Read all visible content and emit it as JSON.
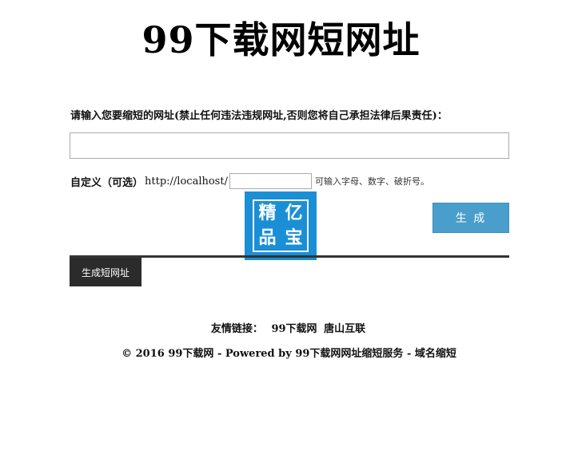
{
  "header": {
    "title": "99下载网短网址"
  },
  "form": {
    "prompt": "请输入您要缩短的网址(禁止任何违法违规网址,否则您将自己承担法律后果责任)：",
    "url_value": "",
    "custom_label": "自定义（可选）",
    "custom_prefix": "http://localhost/",
    "custom_value": "",
    "custom_hint": "可输入字母、数字、破折号。",
    "generate_label": "生 成"
  },
  "watermark": {
    "chars": [
      "精",
      "亿",
      "品",
      "宝"
    ],
    "color": "#1a8fd6"
  },
  "tabs": {
    "generate_short_url": "生成短网址"
  },
  "footer": {
    "links_label": "友情链接：",
    "links": [
      "99下载网",
      "唐山互联"
    ],
    "copyright": "© 2016 99下载网 - Powered by 99下载网网址缩短服务 - 域名缩短"
  },
  "colors": {
    "button": "#4a9ecb",
    "tab": "#2b2b2b",
    "divider": "#333333",
    "watermark": "#1a8fd6"
  }
}
